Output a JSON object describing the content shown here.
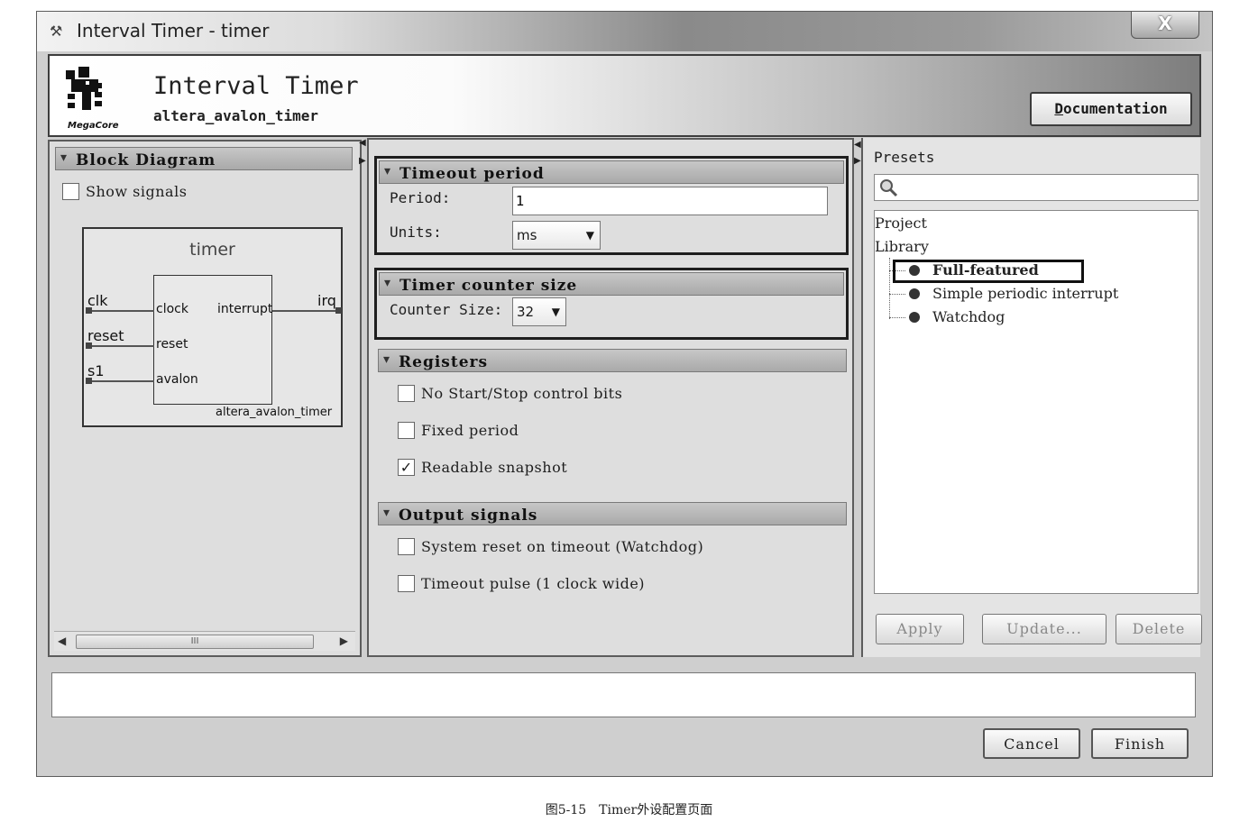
{
  "window": {
    "title": "Interval Timer - timer",
    "close_label": "X"
  },
  "header": {
    "title": "Interval Timer",
    "subtitle": "altera_avalon_timer",
    "logo_text": "MegaCore",
    "documentation_label_first": "D",
    "documentation_label_rest": "ocumentation"
  },
  "block_diagram": {
    "header": "Block Diagram",
    "show_signals_label": "Show signals",
    "show_signals_checked": false,
    "component_name": "timer",
    "ports_left": [
      "clk",
      "reset",
      "s1"
    ],
    "ports_inner_left": [
      "clock",
      "reset",
      "avalon"
    ],
    "port_inner_right": "interrupt",
    "port_right": "irq",
    "module_name": "altera_avalon_timer",
    "scroll_thumb": "III"
  },
  "timeout_period": {
    "header": "Timeout period",
    "period_label": "Period:",
    "period_value": "1",
    "units_label": "Units:",
    "units_value": "ms"
  },
  "timer_counter": {
    "header": "Timer counter size",
    "counter_label": "Counter Size:",
    "counter_value": "32"
  },
  "registers": {
    "header": "Registers",
    "options": [
      {
        "label": "No Start/Stop control bits",
        "checked": false
      },
      {
        "label": "Fixed period",
        "checked": false
      },
      {
        "label": "Readable snapshot",
        "checked": true
      }
    ]
  },
  "output_signals": {
    "header": "Output signals",
    "options": [
      {
        "label": "System reset on timeout (Watchdog)",
        "checked": false
      },
      {
        "label": "Timeout pulse (1 clock wide)",
        "checked": false
      }
    ]
  },
  "presets": {
    "label": "Presets",
    "search_placeholder": "",
    "tree": {
      "project": "Project",
      "library": "Library",
      "items": [
        "Full-featured",
        "Simple periodic interrupt",
        "Watchdog"
      ],
      "selected": "Full-featured"
    },
    "apply_label": "Apply",
    "update_label": "Update...",
    "delete_label": "Delete"
  },
  "footer": {
    "status_text": "",
    "cancel_label": "Cancel",
    "finish_label": "Finish"
  },
  "caption": "图5-15　Timer外设配置页面"
}
